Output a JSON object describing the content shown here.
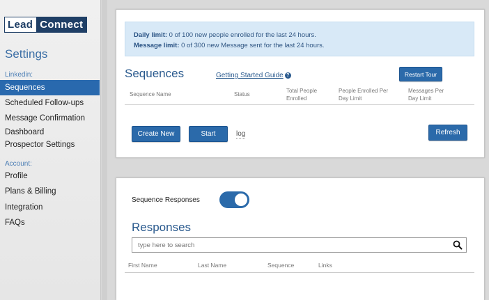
{
  "brand": {
    "lead": "Lead",
    "connect": "Connect"
  },
  "sidebar": {
    "title": "Settings",
    "section_linkedin": "Linkedin:",
    "section_account": "Account:",
    "items": [
      {
        "label": "Sequences",
        "active": true
      },
      {
        "label": "Scheduled Follow-ups"
      },
      {
        "label": "Message Confirmation"
      },
      {
        "label": "Dashboard"
      },
      {
        "label": "Prospector Settings"
      },
      {
        "label": "Profile"
      },
      {
        "label": "Plans & Billing"
      },
      {
        "label": "Integration"
      },
      {
        "label": "FAQs"
      }
    ]
  },
  "limits": {
    "daily_label": "Daily limit:",
    "daily_text": " 0 of 100 new people enrolled for the last 24 hours.",
    "message_label": "Message limit:",
    "message_text": " 0 of 300 new Message sent for the last 24 hours."
  },
  "sequences": {
    "title": "Sequences",
    "guide_link": "Getting Started Guide",
    "restart_tour": "Restart Tour",
    "columns": [
      "Sequence Name",
      "Status",
      "Total People Enrolled",
      "People Enrolled Per Day Limit",
      "Messages Per Day Limit"
    ],
    "create_new": "Create New",
    "start": "Start",
    "log": "log",
    "refresh": "Refresh"
  },
  "responses": {
    "toggle_label": "Sequence Responses",
    "toggle_on": true,
    "title": "Responses",
    "search_placeholder": "type here to search",
    "columns": [
      "First Name",
      "Last Name",
      "Sequence",
      "Links"
    ]
  },
  "colors": {
    "accent": "#2b6aaa",
    "brand_dark": "#1f3f66",
    "active_nav": "#2969ae",
    "info_bg": "#d8e9f7"
  }
}
